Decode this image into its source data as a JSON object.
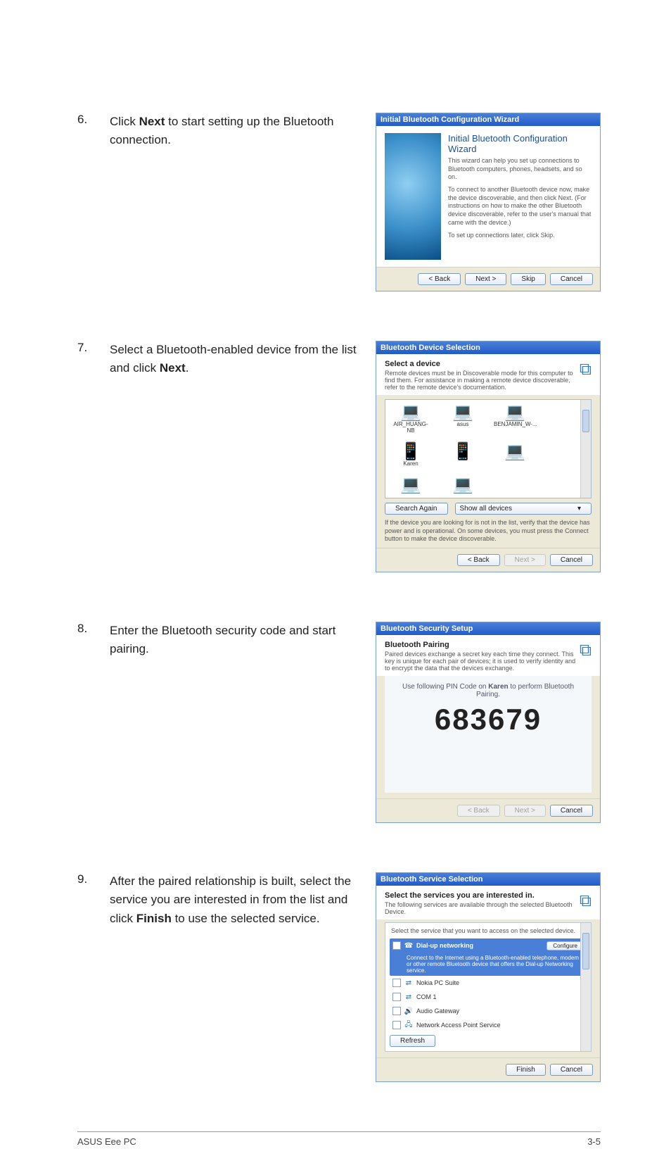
{
  "footer": {
    "left": "ASUS Eee PC",
    "right": "3-5"
  },
  "steps": {
    "s6": {
      "num": "6.",
      "text_pre": "Click ",
      "text_bold": "Next",
      "text_post": " to start setting up the Bluetooth connection."
    },
    "s7": {
      "num": "7.",
      "text_pre": "Select a Bluetooth-enabled device from the list and click ",
      "text_bold": "Next",
      "text_post": "."
    },
    "s8": {
      "num": "8.",
      "text": "Enter the Bluetooth security code and start pairing."
    },
    "s9": {
      "num": "9.",
      "text_pre": "After the paired relationship is built, select the service you are interested in from the list and click ",
      "text_bold": "Finish",
      "text_post": " to use the selected service."
    }
  },
  "dlg1": {
    "title": "Initial Bluetooth Configuration Wizard",
    "heading": "Initial Bluetooth Configuration Wizard",
    "para1": "This wizard can help you set up connections to Bluetooth computers, phones, headsets, and so on.",
    "para2": "To connect to another Bluetooth device now, make the device discoverable, and then click Next. (For instructions on how to make the other Bluetooth device discoverable, refer to the user's manual that came with the device.)",
    "para3": "To set up connections later, click Skip.",
    "btn_back": "< Back",
    "btn_next": "Next >",
    "btn_skip": "Skip",
    "btn_cancel": "Cancel"
  },
  "dlg2": {
    "title": "Bluetooth Device Selection",
    "sub": "Select a device",
    "subtext": "Remote devices must be in Discoverable mode for this computer to find them. For assistance in making a remote device discoverable, refer to the remote device's documentation.",
    "devices": [
      "AIR_HUANG-NB",
      "asus",
      "BENJAMIN_W-...",
      "Karen"
    ],
    "btn_search": "Search Again",
    "sel_show": "Show all devices",
    "note": "If the device you are looking for is not in the list, verify that the device has power and is operational. On some devices, you must press the Connect button to make the device discoverable.",
    "btn_back": "< Back",
    "btn_next": "Next >",
    "btn_cancel": "Cancel"
  },
  "dlg3": {
    "title": "Bluetooth Security Setup",
    "sub": "Bluetooth Pairing",
    "subtext": "Paired devices exchange a secret key each time they connect. This key is unique for each pair of devices; it is used to verify identity and to encrypt the data that the devices exchange.",
    "pin_line_pre": "Use following PIN Code on ",
    "pin_target": "Karen",
    "pin_line_post": " to perform Bluetooth Pairing.",
    "pin_code": "683679",
    "btn_back": "< Back",
    "btn_next": "Next >",
    "btn_cancel": "Cancel"
  },
  "dlg4": {
    "title": "Bluetooth Service Selection",
    "sub": "Select the services you are interested in.",
    "subtext": "The following services are available through the selected Bluetooth Device.",
    "hint": "Select the service that you want to access on the selected device.",
    "svc_sel": "Dial-up networking",
    "svc_sel_desc": "Connect to the Internet using a Bluetooth-enabled telephone, modem or other remote Bluetooth device that offers the Dial-up Networking service.",
    "btn_configure": "Configure",
    "svc2": "Nokia PC Suite",
    "svc3": "COM 1",
    "svc4": "Audio Gateway",
    "svc5": "Network Access Point Service",
    "btn_refresh": "Refresh",
    "btn_finish": "Finish",
    "btn_cancel": "Cancel"
  }
}
